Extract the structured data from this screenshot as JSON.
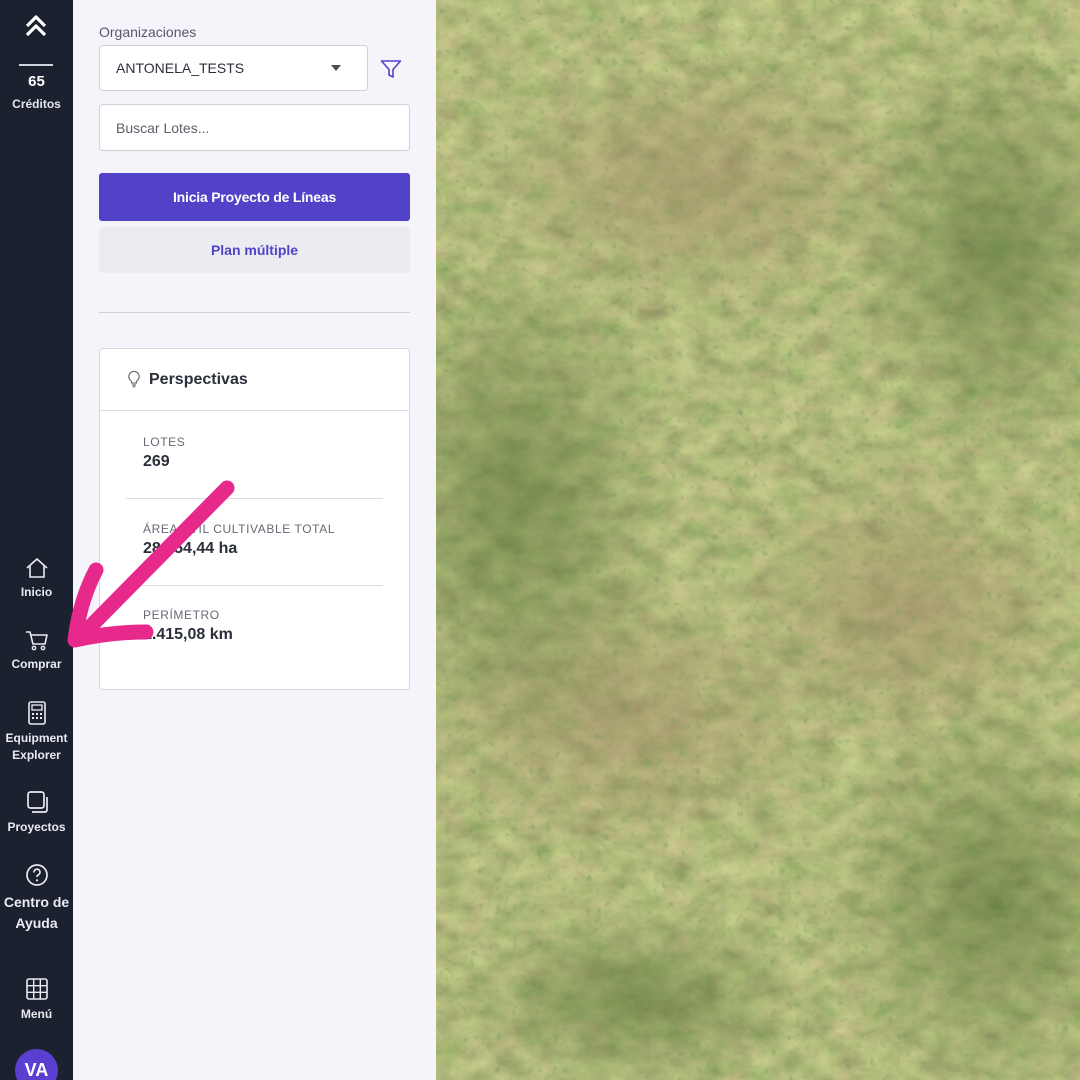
{
  "nav": {
    "credits_value": "65",
    "credits_label": "Créditos",
    "items": [
      {
        "label": "Inicio",
        "icon": "home-icon"
      },
      {
        "label": "Comprar",
        "icon": "cart-icon"
      },
      {
        "label": "Equipment Explorer",
        "icon": "calculator-icon"
      },
      {
        "label": "Proyectos",
        "icon": "projects-icon"
      },
      {
        "label": "Centro de Ayuda",
        "icon": "help-icon"
      },
      {
        "label": "Menú",
        "icon": "grid-icon"
      }
    ],
    "avatar_initials": "VA"
  },
  "panel": {
    "org_label": "Organizaciones",
    "org_value": "ANTONELA_TESTS",
    "search_placeholder": "Buscar Lotes...",
    "primary_button": "Inicia Proyecto de Líneas",
    "secondary_button": "Plan múltiple"
  },
  "insights": {
    "title": "Perspectivas",
    "icon": "lightbulb-icon",
    "stats": [
      {
        "label": "LOTES",
        "value": "269"
      },
      {
        "label": "ÁREA ÚTIL CULTIVABLE TOTAL",
        "value": "28.454,44 ha"
      },
      {
        "label": "PERÍMETRO",
        "value": "1.415,08 km"
      }
    ]
  },
  "colors": {
    "nav_bg": "#1c2130",
    "accent": "#5242c8",
    "annotation_arrow": "#e8298c"
  }
}
